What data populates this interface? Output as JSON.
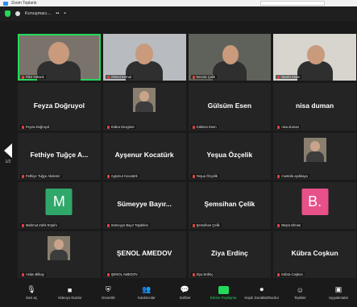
{
  "window": {
    "title": "Zoom Toplantı"
  },
  "topbar": {
    "speaker": "Konuşmacı..."
  },
  "participants": [
    {
      "name": "Fikri Yüksek",
      "caption": "Fikri Yüksek",
      "kind": "video"
    },
    {
      "name": "Ahmet Kemal",
      "caption": "Ahmet Kemal",
      "kind": "video"
    },
    {
      "name": "Nevzat Çelik",
      "caption": "Nevzat Çelik",
      "kind": "video"
    },
    {
      "name": "Sevim Aslan",
      "caption": "Sevim Aslan",
      "kind": "video"
    },
    {
      "name": "Feyza Doğruyol",
      "caption": "Feyza Doğruyol",
      "kind": "name"
    },
    {
      "name": "",
      "caption": "Kübra Devginer",
      "kind": "thumb"
    },
    {
      "name": "Gülsüm Esen",
      "caption": "Gülsüm Esen",
      "kind": "name"
    },
    {
      "name": "nisa duman",
      "caption": "nisa duman",
      "kind": "name"
    },
    {
      "name": "Fethiye Tuğçe A...",
      "caption": "Fethiye Tuğçe Akdemir",
      "kind": "name"
    },
    {
      "name": "Ayşenur Kocatürk",
      "caption": "Ayşenur Kocatürk",
      "kind": "name"
    },
    {
      "name": "Yeşua Özçelik",
      "caption": "Yeşua Özçelik",
      "kind": "name"
    },
    {
      "name": "",
      "caption": "mustafa aşıkkaya",
      "kind": "thumb"
    },
    {
      "name": "M",
      "caption": "Mahmut Zahit Erşahı",
      "kind": "avatar",
      "color": "#2fa86a"
    },
    {
      "name": "Sümeyye Bayır...",
      "caption": "Sümeyye Bayır Taşdelen",
      "kind": "name"
    },
    {
      "name": "Şemsihan Çelik",
      "caption": "Şemsihan Çelik",
      "kind": "name"
    },
    {
      "name": "B.",
      "caption": "Büşra Elmas",
      "kind": "avatar",
      "color": "#e8508a"
    },
    {
      "name": "",
      "caption": "Aslan Bilkay",
      "kind": "thumb"
    },
    {
      "name": "ŞENOL AMEDOV",
      "caption": "ŞENOL AMEDOV",
      "kind": "name"
    },
    {
      "name": "Ziya Erdinç",
      "caption": "Ziya Erdinç",
      "kind": "name"
    },
    {
      "name": "Kübra Coşkun",
      "caption": "Kübra Coşkun",
      "kind": "name"
    }
  ],
  "pager": {
    "page": "1/2"
  },
  "toolbar": {
    "items": [
      {
        "icon": "microphone-icon",
        "glyph": "🎙",
        "label": "Sesi aç"
      },
      {
        "icon": "video-camera-icon",
        "glyph": "■",
        "label": "Videoyu Durdur"
      },
      {
        "icon": "shield-icon",
        "glyph": "⛨",
        "label": "Güvenlik"
      },
      {
        "icon": "participants-icon",
        "glyph": "👥",
        "label": "Katılımcılar"
      },
      {
        "icon": "chat-icon",
        "glyph": "💬",
        "label": "Sohbet"
      },
      {
        "icon": "share-screen-icon",
        "glyph": "",
        "label": "Ekranı Paylaşma"
      },
      {
        "icon": "record-icon",
        "glyph": "⏺",
        "label": "Kaydı Duraklat/Durdur"
      },
      {
        "icon": "reactions-icon",
        "glyph": "☺",
        "label": "Tepkiler"
      },
      {
        "icon": "apps-icon",
        "glyph": "▣",
        "label": "Uygulamalar"
      }
    ]
  },
  "colors": {
    "active_speaker": "#23d959",
    "mic_muted": "#e0443e",
    "background": "#1a1a1a"
  }
}
